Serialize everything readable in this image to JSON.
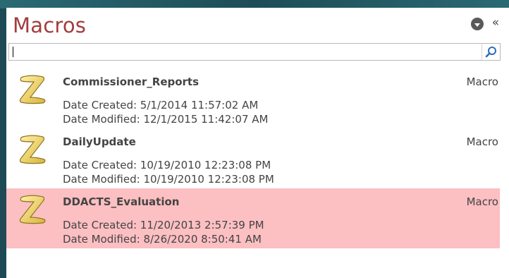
{
  "panel": {
    "title": "Macros",
    "collapse_glyph": "«",
    "menu_icon": "chevron-down-circle-icon",
    "search": {
      "value": "",
      "placeholder": "",
      "icon": "search-icon"
    }
  },
  "items": [
    {
      "name": "Commissioner_Reports",
      "type": "Macro",
      "created": "Date Created: 5/1/2014 11:57:02 AM",
      "modified": "Date Modified: 12/1/2015 11:42:07 AM",
      "icon": "macro-scroll-icon",
      "selected": false
    },
    {
      "name": "DailyUpdate",
      "type": "Macro",
      "created": "Date Created: 10/19/2010 12:23:08 PM",
      "modified": "Date Modified: 10/19/2010 12:23:08 PM",
      "icon": "macro-scroll-icon",
      "selected": false
    },
    {
      "name": "DDACTS_Evaluation",
      "type": "Macro",
      "created": "Date Created: 11/20/2013 2:57:39 PM",
      "modified": "Date Modified: 8/26/2020 8:50:41 AM",
      "icon": "macro-scroll-icon",
      "selected": true
    }
  ],
  "colors": {
    "title": "#a33d3d",
    "selected_row": "#fcbfc2",
    "background": "#1e4a55"
  }
}
